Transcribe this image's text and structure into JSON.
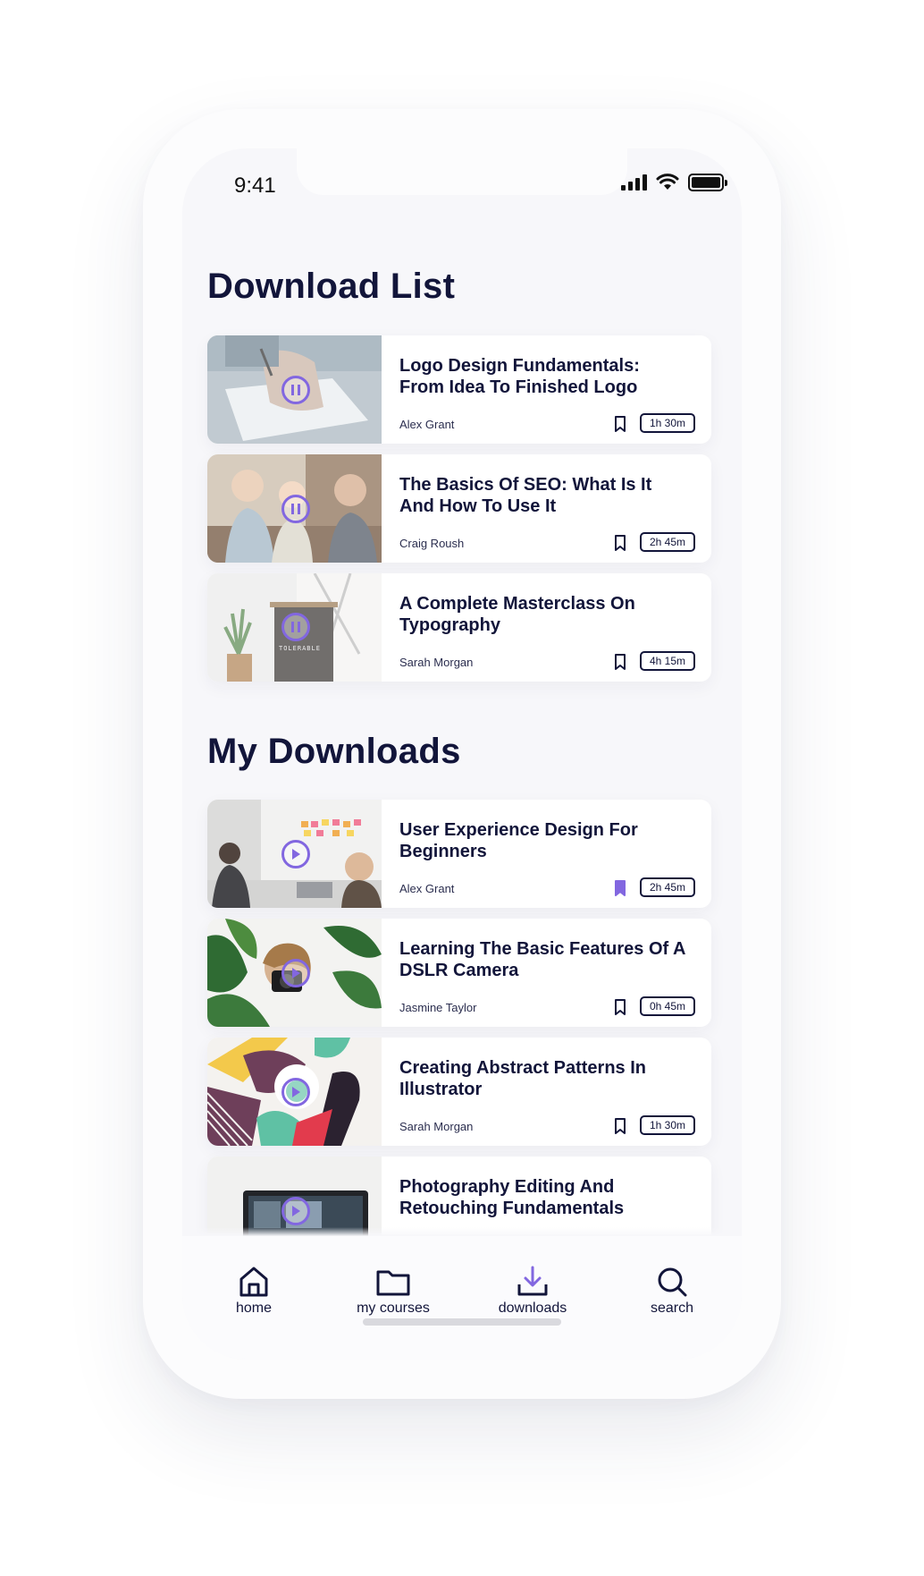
{
  "status_bar": {
    "time": "9:41"
  },
  "download_list": {
    "title": "Download List",
    "items": [
      {
        "title": "Logo Design Fundamentals: From Idea To Finished Logo",
        "author": "Alex Grant",
        "duration": "1h 30m",
        "state": "paused",
        "bookmarked": false
      },
      {
        "title": "The Basics Of SEO: What Is It And How To Use It",
        "author": "Craig Roush",
        "duration": "2h 45m",
        "state": "paused",
        "bookmarked": false
      },
      {
        "title": "A Complete Masterclass On Typography",
        "author": "Sarah Morgan",
        "duration": "4h 15m",
        "state": "paused",
        "bookmarked": false,
        "thumb_text": "TOLERABLE"
      }
    ]
  },
  "my_downloads": {
    "title": "My Downloads",
    "items": [
      {
        "title": "User Experience Design For Beginners",
        "author": "Alex Grant",
        "duration": "2h 45m",
        "state": "play",
        "bookmarked": true
      },
      {
        "title": "Learning The Basic Features Of A DSLR Camera",
        "author": "Jasmine Taylor",
        "duration": "0h 45m",
        "state": "play",
        "bookmarked": false
      },
      {
        "title": "Creating Abstract Patterns In Illustrator",
        "author": "Sarah Morgan",
        "duration": "1h 30m",
        "state": "play",
        "bookmarked": false
      },
      {
        "title": "Photography Editing And Retouching Fundamentals",
        "state": "play"
      }
    ]
  },
  "tabbar": {
    "home": "home",
    "courses": "my courses",
    "downloads": "downloads",
    "search": "search",
    "active": "downloads"
  },
  "colors": {
    "accent": "#8267e0",
    "text_dark": "#12153a",
    "background": "#f7f7fa"
  },
  "icons": [
    "pause-icon",
    "play-icon",
    "bookmark-icon",
    "home-icon",
    "folder-icon",
    "download-icon",
    "search-icon",
    "signal-icon",
    "wifi-icon",
    "battery-icon"
  ]
}
